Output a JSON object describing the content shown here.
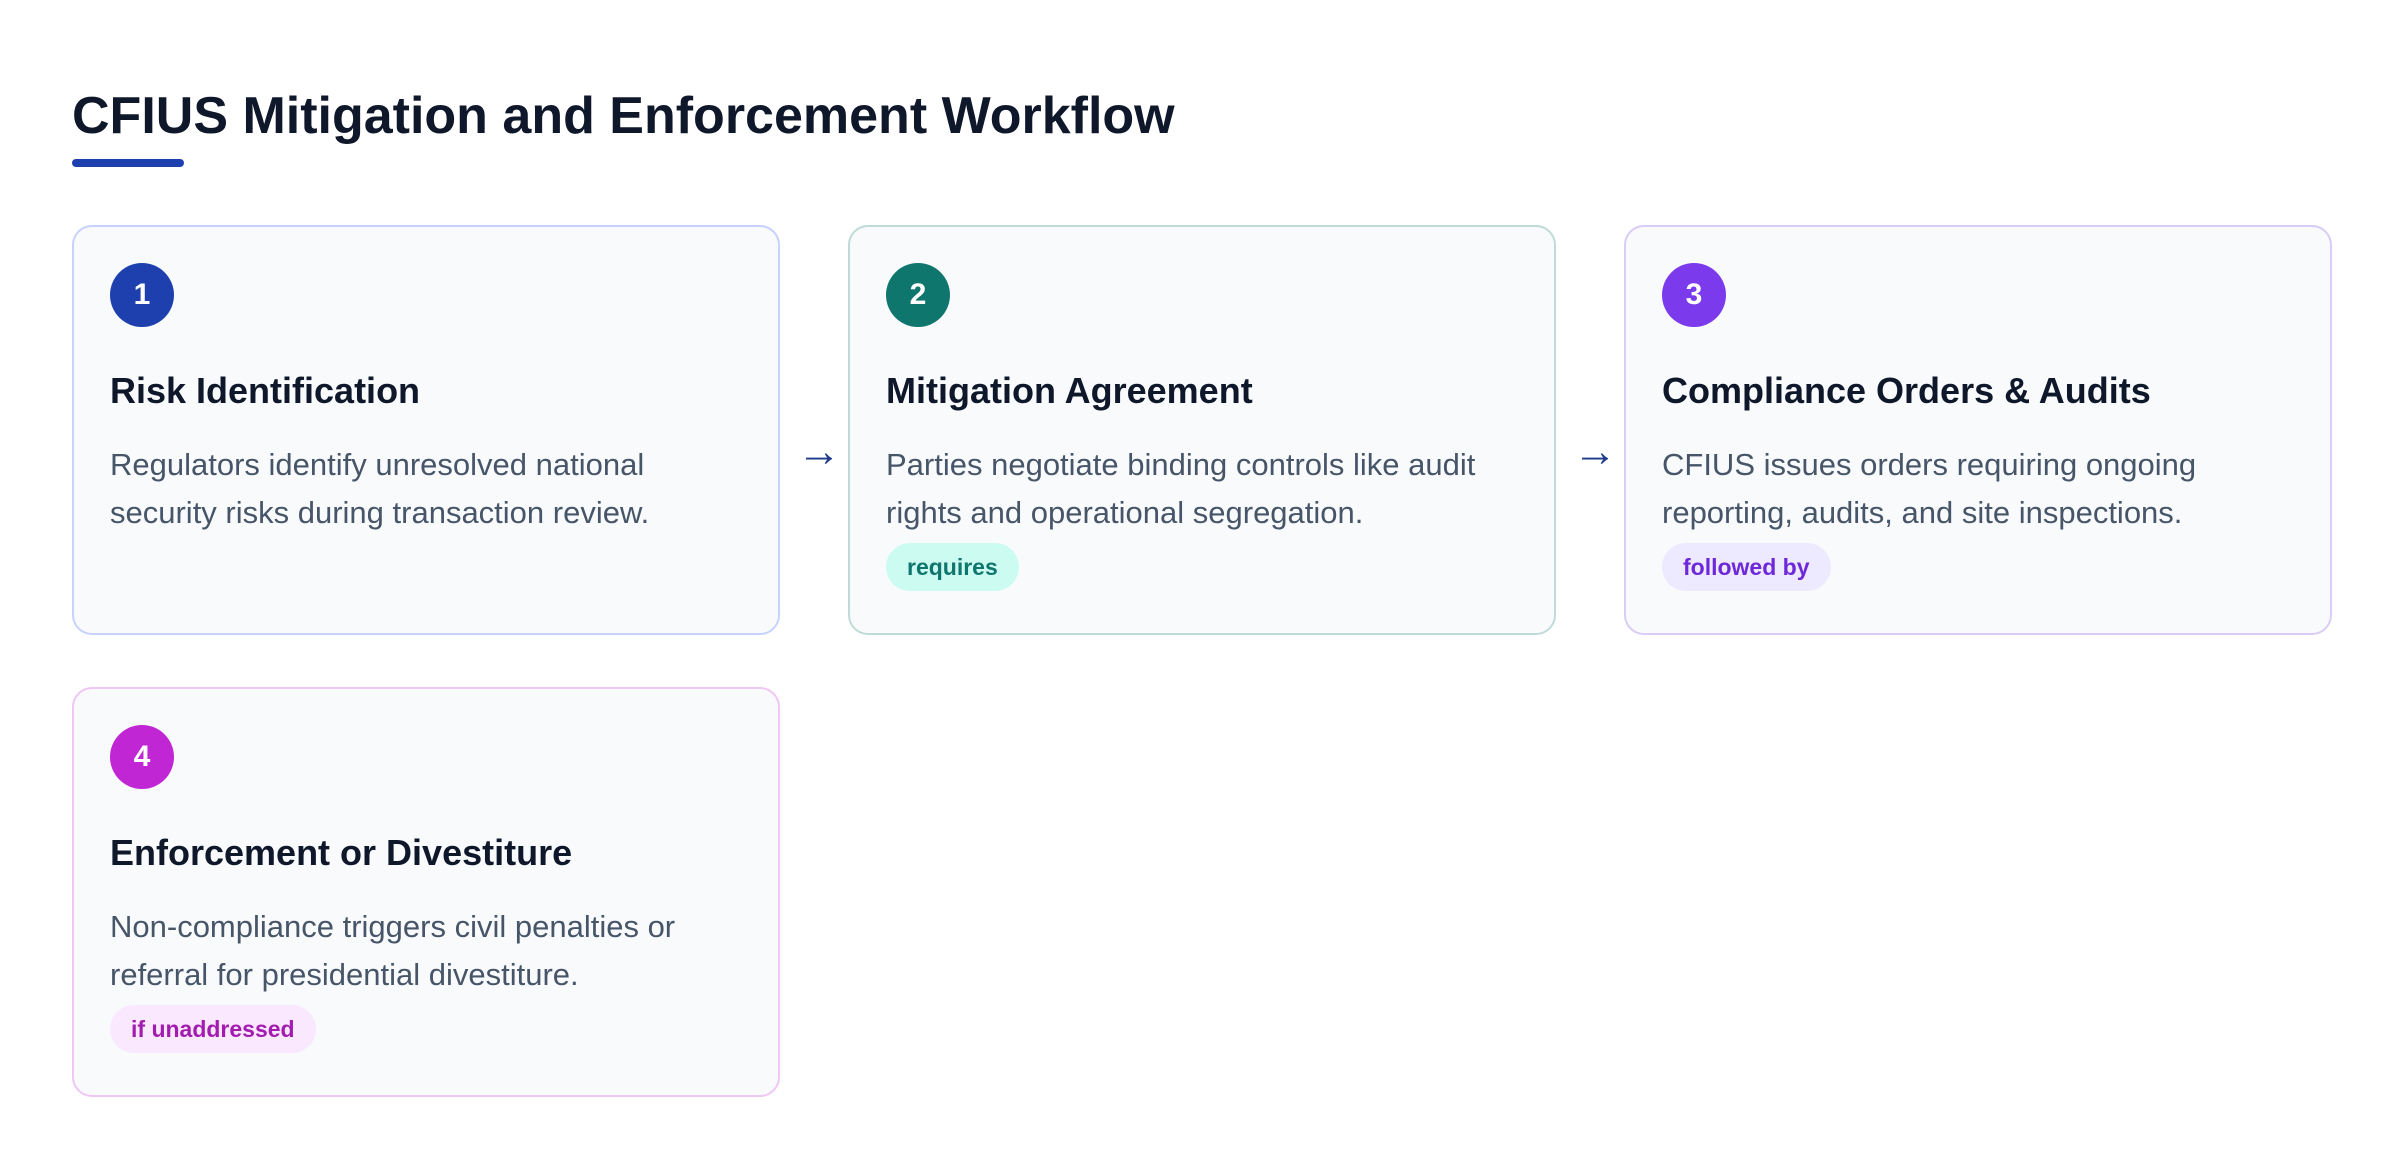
{
  "title": "CFIUS Mitigation and Enforcement Workflow",
  "steps": [
    {
      "number": "1",
      "title": "Risk Identification",
      "description": "Regulators identify unresolved national security risks during transaction review.",
      "tag": "",
      "accent_color": "#1e40af",
      "border_color": "#c7d2fe",
      "tag_bg": "",
      "tag_color": ""
    },
    {
      "number": "2",
      "title": "Mitigation Agreement",
      "description": "Parties negotiate binding controls like audit rights and operational segregation.",
      "tag": "requires",
      "accent_color": "#0f766e",
      "border_color": "#bfdbd8",
      "tag_bg": "#ccfbf1",
      "tag_color": "#0f766e"
    },
    {
      "number": "3",
      "title": "Compliance Orders & Audits",
      "description": "CFIUS issues orders requiring ongoing reporting, audits, and site inspections.",
      "tag": "followed by",
      "accent_color": "#7c3aed",
      "border_color": "#d9ccf7",
      "tag_bg": "#ede9fe",
      "tag_color": "#6d28d9"
    },
    {
      "number": "4",
      "title": "Enforcement or Divestiture",
      "description": "Non-compliance triggers civil penalties or referral for presidential divestiture.",
      "tag": "if unaddressed",
      "accent_color": "#c026d3",
      "border_color": "#f0c6f4",
      "tag_bg": "#fae8ff",
      "tag_color": "#a21caf"
    }
  ],
  "connectors": [
    {
      "symbol": "→"
    },
    {
      "symbol": "→"
    }
  ]
}
